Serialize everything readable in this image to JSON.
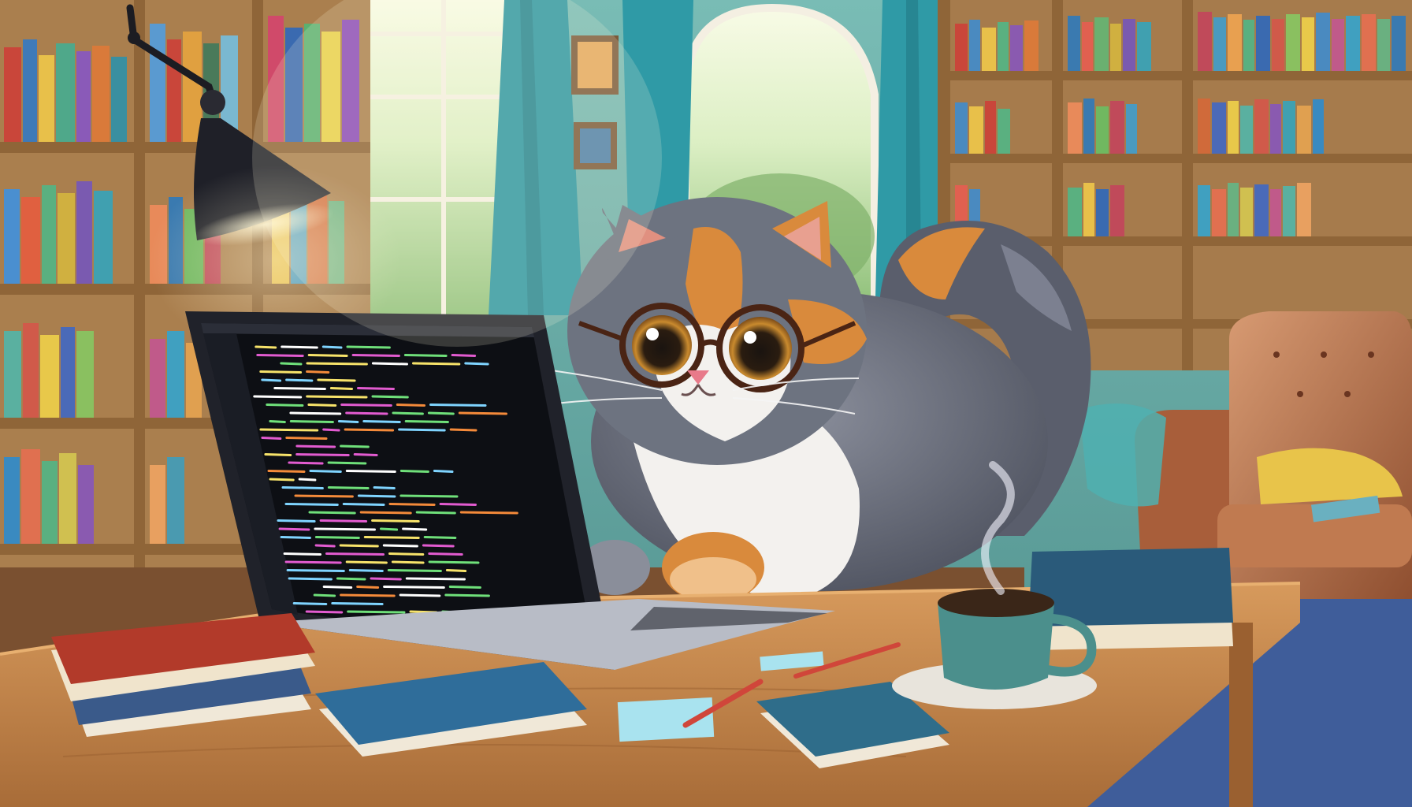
{
  "scene": {
    "subject": "calico-cat",
    "palette": {
      "wall": "#5fa9a8",
      "window_light": "#eef6dc",
      "foliage": "#8fc07a",
      "curtain": "#2f9aa6",
      "shelf_wood": "#b98a55",
      "desk_wood": "#c48a4e",
      "armchair": "#b8724a",
      "rug": "#3f5d9a",
      "cat_gray": "#6d7380",
      "cat_white": "#f3f1ee",
      "cat_orange": "#d98a3c",
      "glasses": "#4a2414",
      "screen": "#0d0f14",
      "mug": "#4b8f8c"
    },
    "code_line_colors": [
      "#e25bd0",
      "#f7e36a",
      "#6fe07a",
      "#ffffff",
      "#f48a3a",
      "#7fd4ff"
    ]
  }
}
